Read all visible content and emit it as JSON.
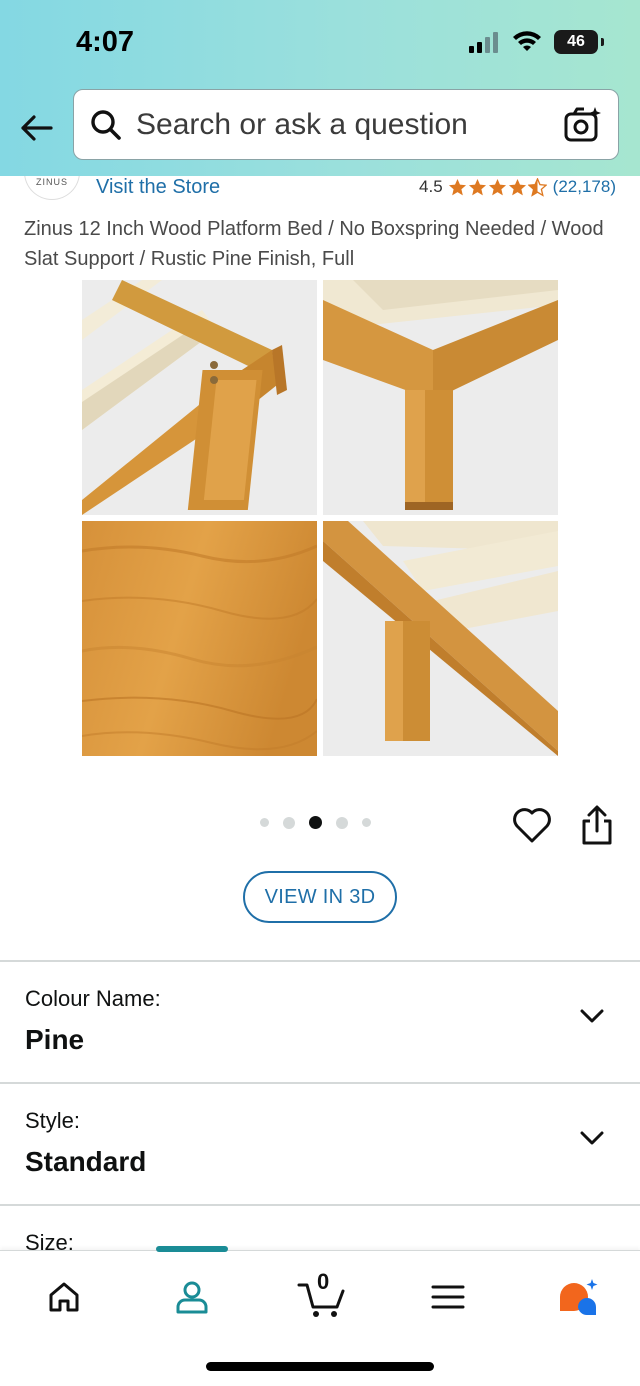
{
  "status": {
    "time": "4:07",
    "battery": "46"
  },
  "search": {
    "placeholder": "Search or ask a question"
  },
  "store": {
    "brand": "ZINUS",
    "link_label": "Visit the Store"
  },
  "rating": {
    "value": "4.5",
    "count": "(22,178)",
    "stars": 4.5
  },
  "product": {
    "title": "Zinus 12 Inch Wood Platform Bed / No Boxspring Needed / Wood Slat Support / Rustic Pine Finish, Full"
  },
  "gallery": {
    "dot_count": 5,
    "active_dot": 2
  },
  "view3d_label": "VIEW IN 3D",
  "variations": [
    {
      "label": "Colour Name:",
      "value": "Pine"
    },
    {
      "label": "Style:",
      "value": "Standard"
    },
    {
      "label": "Size:",
      "value": ""
    }
  ],
  "nav": {
    "cart_count": "0"
  },
  "colors": {
    "accent": "#1f6fa8",
    "nav_active": "#1a8c96",
    "star": "#de7921",
    "rufus_orange": "#f2661d",
    "rufus_blue": "#1a73e8"
  }
}
